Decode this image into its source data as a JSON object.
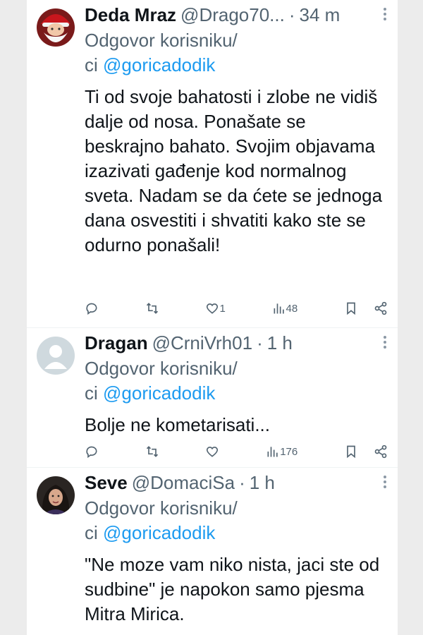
{
  "tweets": [
    {
      "name": "Deda Mraz",
      "handle": "@Drago70...",
      "time": "34 m",
      "reply_prefix": "Odgovor korisniku/",
      "reply_cont": "ci ",
      "mention": "@goricadodik",
      "body": "Ti od svoje bahatosti i zlobe ne vidiš dalje od nosa. Ponašate se beskrajno bahato. Svojim objavama izazivati gađenje kod normalnog sveta. Nadam se da ćete se jednoga dana osvestiti i shvatiti kako ste se odurno ponašali!",
      "likes": "1",
      "views": "48",
      "avatar_icon": "santa-avatar"
    },
    {
      "name": "Dragan",
      "handle": "@CrniVrh01",
      "time": "1 h",
      "reply_prefix": "Odgovor korisniku/",
      "reply_cont": "ci ",
      "mention": "@goricadodik",
      "body": "Bolje ne kometarisati...",
      "likes": "",
      "views": "176",
      "avatar_icon": "default-avatar"
    },
    {
      "name": "Seve",
      "handle": "@DomaciSa",
      "time": "1 h",
      "reply_prefix": "Odgovor korisniku/",
      "reply_cont": "ci ",
      "mention": "@goricadodik",
      "body": "\"Ne moze vam niko nista, jaci ste od sudbine\" je napokon samo pjesma Mitra Mirica.",
      "avatar_icon": "woman-photo-avatar"
    }
  ],
  "colors": {
    "text": "#0f1419",
    "muted": "#536471",
    "link": "#1d9bf0",
    "divider": "#eff3f4"
  }
}
